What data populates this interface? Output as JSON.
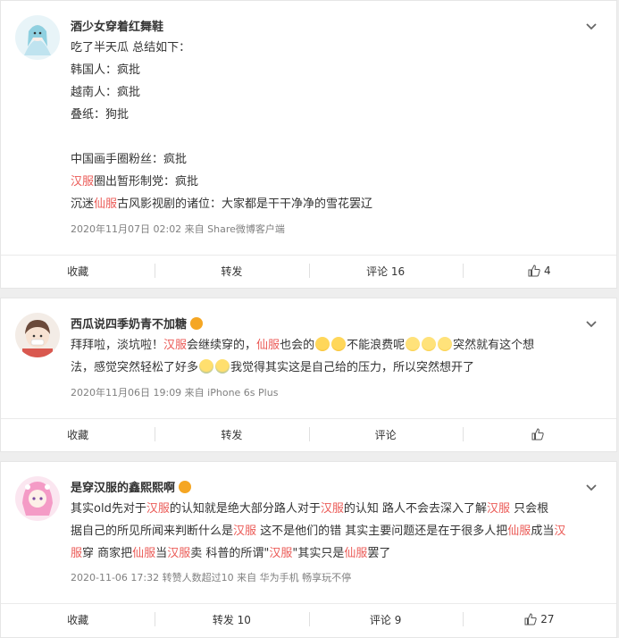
{
  "comments": [
    {
      "username": "酒少女穿着红舞鞋",
      "lines": [
        [
          {
            "t": "吃了半天瓜 总结如下："
          }
        ],
        [
          {
            "t": "韩国人：疯批"
          }
        ],
        [
          {
            "t": "越南人：疯批"
          }
        ],
        [
          {
            "t": "叠纸：狗批"
          }
        ],
        [
          {
            "t": ""
          }
        ],
        [
          {
            "t": "中国画手圈粉丝：疯批"
          }
        ],
        [
          {
            "t": "汉服",
            "hl": true
          },
          {
            "t": "圈出暂形制党：疯批"
          }
        ],
        [
          {
            "t": "沉迷"
          },
          {
            "t": "仙服",
            "hl": true
          },
          {
            "t": "古风影视剧的诸位：大家都是干干净净的雪花罢辽"
          }
        ]
      ],
      "meta": "2020年11月07日 02:02   来自 Share微博客户端",
      "actions": {
        "collect": "收藏",
        "repost": "转发",
        "comment": "评论 16",
        "like": "4"
      }
    },
    {
      "username": "西瓜说四季奶青不加糖",
      "lines": [
        [
          {
            "t": "拜拜啦，淡坑啦！"
          },
          {
            "t": "汉服",
            "hl": true
          },
          {
            "t": "会继续穿的，"
          },
          {
            "t": "仙服",
            "hl": true
          },
          {
            "t": "也会的"
          },
          {
            "emo": "laugh"
          },
          {
            "emo": "laugh"
          },
          {
            "t": "不能浪费呢"
          },
          {
            "emo": "smile"
          },
          {
            "emo": "smile"
          },
          {
            "emo": "smile"
          },
          {
            "t": "突然就有这个想"
          }
        ],
        [
          {
            "t": "法，感觉突然轻松了好多"
          },
          {
            "emo": "cry"
          },
          {
            "emo": "cry"
          },
          {
            "t": "我觉得其实这是自己给的压力，所以突然想开了"
          }
        ]
      ],
      "meta": "2020年11月06日 19:09   来自 iPhone 6s Plus",
      "actions": {
        "collect": "收藏",
        "repost": "转发",
        "comment": "评论",
        "like": ""
      }
    },
    {
      "username": "是穿汉服的鑫熙熙啊",
      "lines": [
        [
          {
            "t": "其实old先对于"
          },
          {
            "t": "汉服",
            "hl": true
          },
          {
            "t": "的认知就是绝大部分路人对于"
          },
          {
            "t": "汉服",
            "hl": true
          },
          {
            "t": "的认知 路人不会去深入了解"
          },
          {
            "t": "汉服",
            "hl": true
          },
          {
            "t": " 只会根"
          }
        ],
        [
          {
            "t": "据自己的所见所闻来判断什么是"
          },
          {
            "t": "汉服",
            "hl": true
          },
          {
            "t": " 这不是他们的错 其实主要问题还是在于很多人把"
          },
          {
            "t": "仙服",
            "hl": true
          },
          {
            "t": "成当"
          },
          {
            "t": "汉",
            "hl": true
          }
        ],
        [
          {
            "t": "服",
            "hl": true
          },
          {
            "t": "穿 商家把"
          },
          {
            "t": "仙服",
            "hl": true
          },
          {
            "t": "当"
          },
          {
            "t": "汉服",
            "hl": true
          },
          {
            "t": "卖 科普的所谓\""
          },
          {
            "t": "汉服",
            "hl": true
          },
          {
            "t": "\"其实只是"
          },
          {
            "t": "仙服",
            "hl": true
          },
          {
            "t": "罢了"
          }
        ]
      ],
      "meta": "2020-11-06 17:32   转赞人数超过10   来自 华为手机 畅享玩不停",
      "actions": {
        "collect": "收藏",
        "repost": "转发 10",
        "comment": "评论 9",
        "like": "27"
      }
    }
  ],
  "colors": {
    "highlight": "#eb5a56",
    "meta": "#808080"
  }
}
